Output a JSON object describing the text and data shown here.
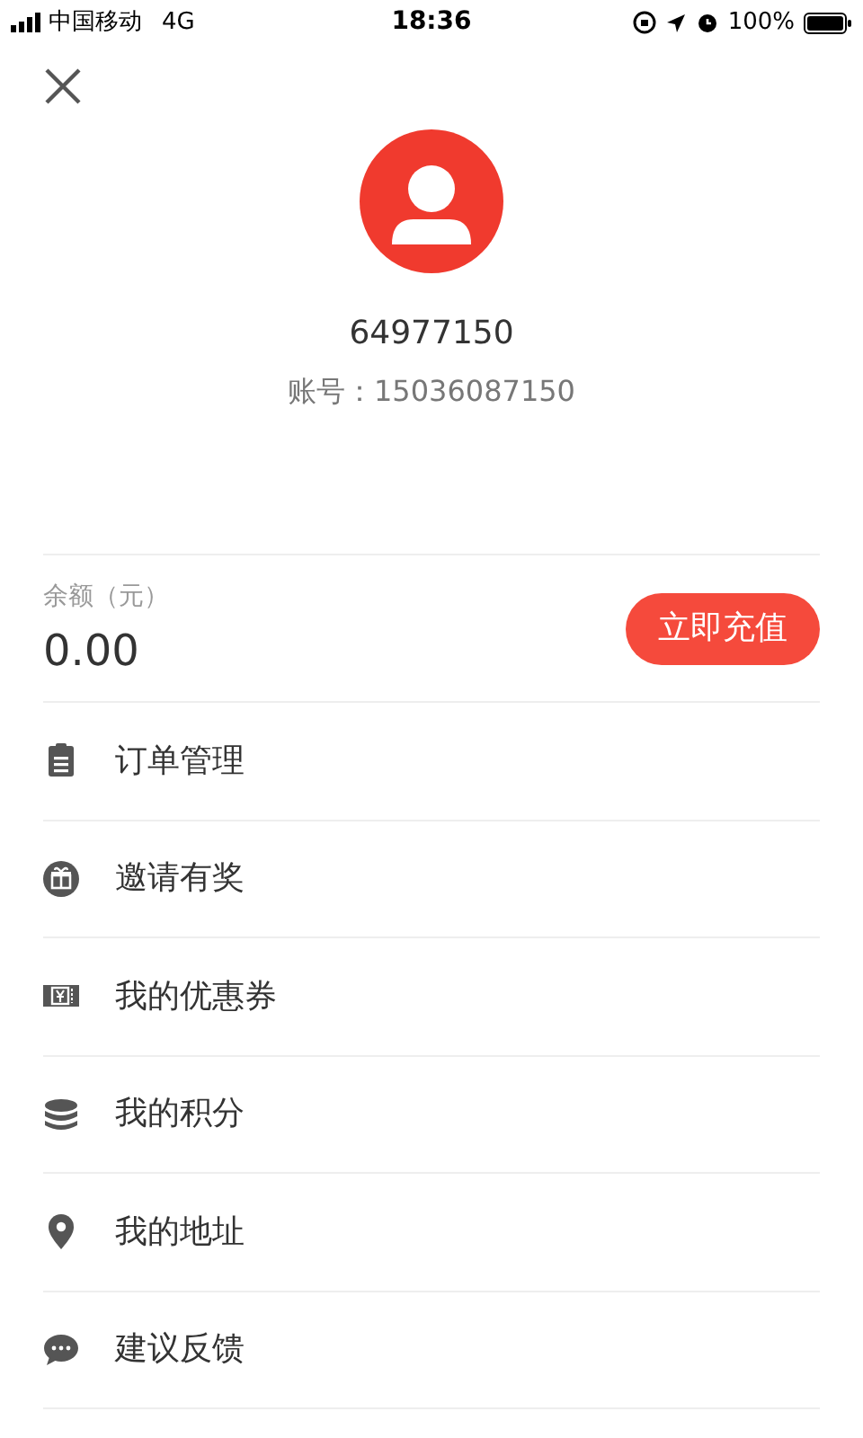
{
  "status_bar": {
    "carrier": "中国移动",
    "network": "4G",
    "time": "18:36",
    "battery": "100%"
  },
  "profile": {
    "name": "64977150",
    "account": "账号：15036087150"
  },
  "balance": {
    "label": "余额（元）",
    "amount": "0.00",
    "button": "立即充值"
  },
  "menu": [
    {
      "label": "订单管理"
    },
    {
      "label": "邀请有奖"
    },
    {
      "label": "我的优惠券"
    },
    {
      "label": "我的积分"
    },
    {
      "label": "我的地址"
    },
    {
      "label": "建议反馈"
    }
  ]
}
